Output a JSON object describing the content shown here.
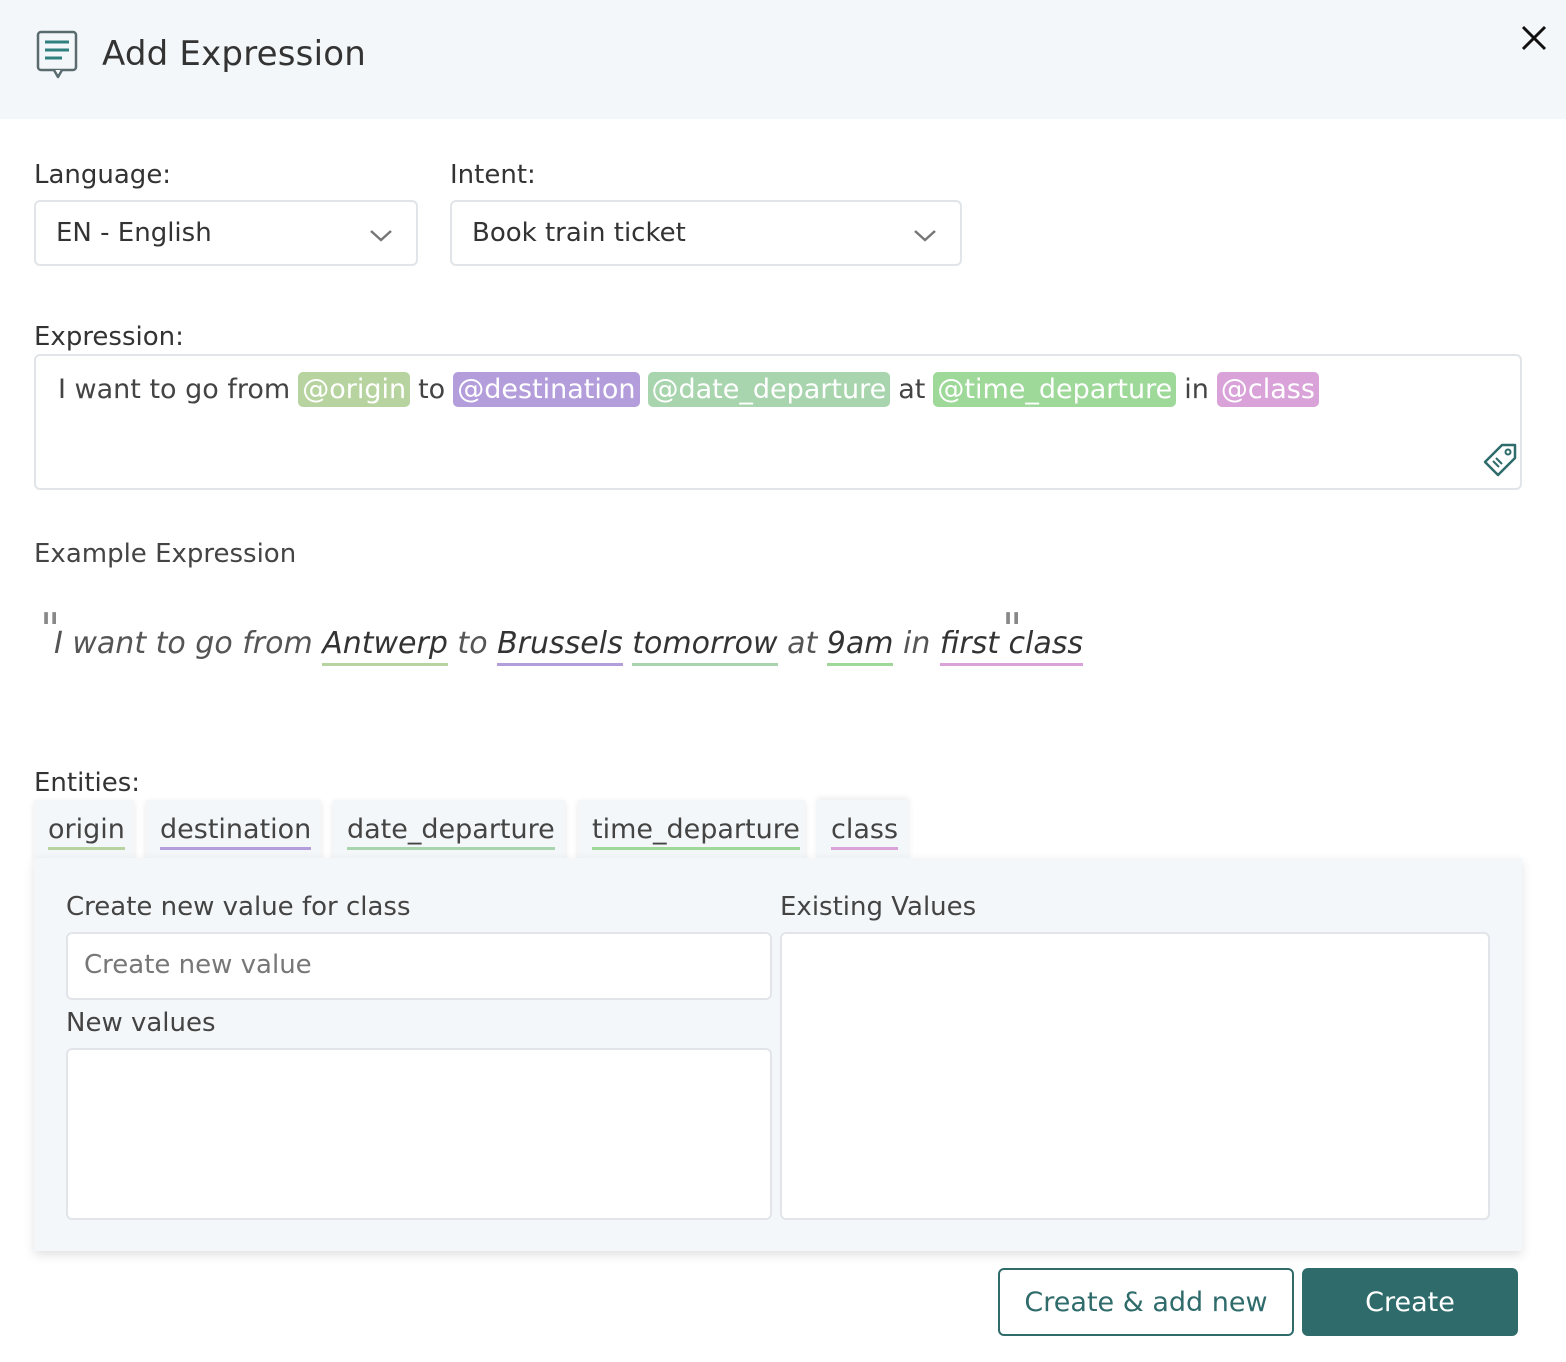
{
  "header": {
    "title": "Add Expression",
    "icon": "document-chat-icon",
    "close_icon": "close-icon"
  },
  "language": {
    "label": "Language:",
    "value": "EN - English"
  },
  "intent": {
    "label": "Intent:",
    "value": "Book train ticket"
  },
  "expression": {
    "label": "Expression:",
    "parts": [
      {
        "text": "I want to go from"
      },
      {
        "entity": "@origin",
        "color": "#b7d39f"
      },
      {
        "text": "to"
      },
      {
        "entity": "@destination",
        "color": "#b39ddb"
      },
      {
        "entity": "@date_departure",
        "color": "#a8d5ae"
      },
      {
        "text": "at"
      },
      {
        "entity": "@time_departure",
        "color": "#9ed99a"
      },
      {
        "text": "in"
      },
      {
        "entity": "@class",
        "color": "#d9a3d9"
      }
    ]
  },
  "example": {
    "title": "Example Expression",
    "parts": [
      {
        "text": "I want to go from "
      },
      {
        "entity": "Antwerp",
        "color": "#b7d39f"
      },
      {
        "text": " to "
      },
      {
        "entity": "Brussels",
        "color": "#b39ddb"
      },
      {
        "text": " "
      },
      {
        "entity": "tomorrow",
        "color": "#a8d5ae"
      },
      {
        "text": " at "
      },
      {
        "entity": "9am",
        "color": "#9ed99a"
      },
      {
        "text": " in "
      },
      {
        "entity": "first class",
        "color": "#d9a3d9"
      }
    ]
  },
  "entities": {
    "label": "Entities:",
    "tabs": [
      {
        "label": "origin",
        "color": "#b7d39f"
      },
      {
        "label": "destination",
        "color": "#b39ddb"
      },
      {
        "label": "date_departure",
        "color": "#a8d5ae"
      },
      {
        "label": "time_departure",
        "color": "#9ed99a"
      },
      {
        "label": "class",
        "color": "#d9a3d9"
      }
    ]
  },
  "panel": {
    "create_label": "Create new value for class",
    "create_placeholder": "Create new value",
    "new_values_label": "New values",
    "existing_label": "Existing Values"
  },
  "buttons": {
    "create_add_new": "Create & add new",
    "create": "Create"
  },
  "colors": {
    "primary": "#2f6b6b",
    "header_bg": "#f4f7f9"
  }
}
